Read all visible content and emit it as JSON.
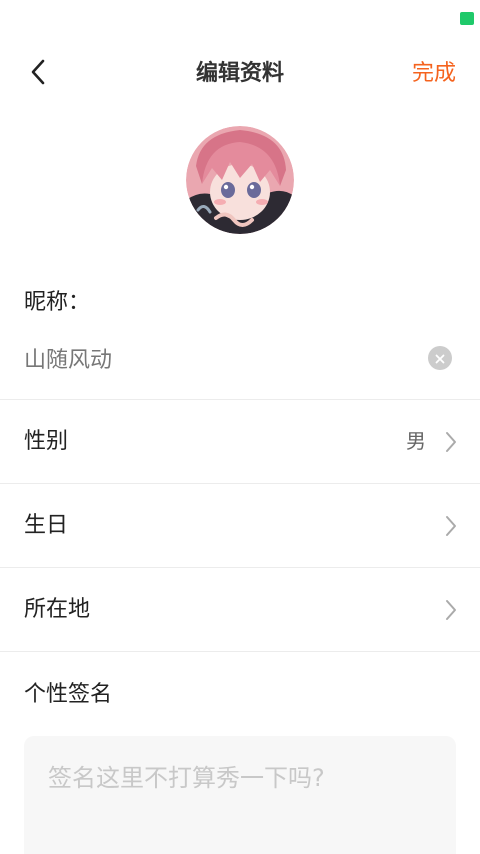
{
  "status_bar": {
    "indicator_color": "#1fc96a"
  },
  "header": {
    "back_icon": "chevron-left-icon",
    "title": "编辑资料",
    "done_label": "完成",
    "accent_color": "#f5631e"
  },
  "profile": {
    "avatar_icon": "anime-avatar"
  },
  "nickname": {
    "label": "昵称：",
    "value": "山随风动",
    "clear_icon": "clear-icon"
  },
  "rows": [
    {
      "label": "性别",
      "value": "男",
      "icon": "chevron-right-icon"
    },
    {
      "label": "生日",
      "value": "",
      "icon": "chevron-right-icon"
    },
    {
      "label": "所在地",
      "value": "",
      "icon": "chevron-right-icon"
    }
  ],
  "signature": {
    "label": "个性签名",
    "placeholder": "签名这里不打算秀一下吗?",
    "value": ""
  }
}
